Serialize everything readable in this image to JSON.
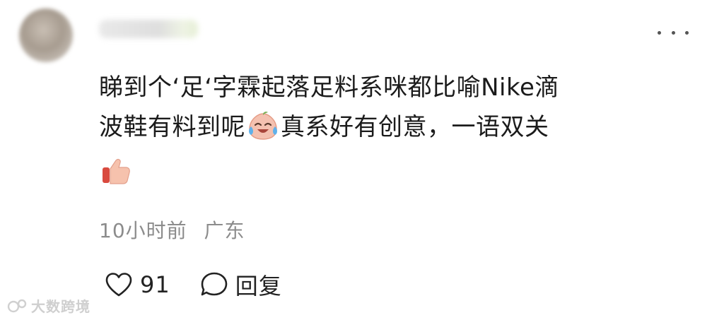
{
  "comment": {
    "text_line1": "睇到个‘足‘字霖起落足料系咪都比喻Nike滴",
    "text_line2_before": "波鞋有料到呢",
    "text_line2_after": "真系好有创意，一语双关",
    "emoji_1": "laughing-crying-peach-emoji",
    "emoji_2": "thumbs-up-emoji"
  },
  "meta": {
    "time": "10小时前",
    "location": "广东"
  },
  "actions": {
    "like_count": "91",
    "reply_label": "回复"
  },
  "watermark": {
    "text": "大数跨境"
  },
  "colors": {
    "text": "#1b1b1b",
    "meta": "#8c8c8c",
    "icon": "#222222"
  }
}
